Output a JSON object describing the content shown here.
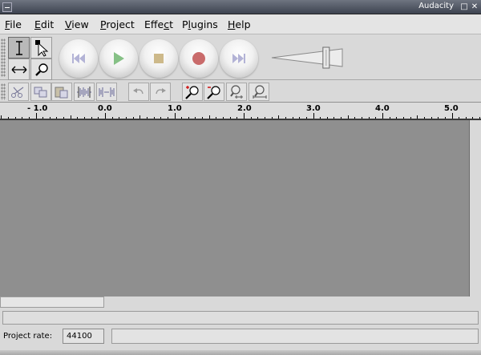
{
  "window": {
    "title": "Audacity"
  },
  "menubar": {
    "items": [
      {
        "before": "",
        "mnemonic": "F",
        "after": "ile"
      },
      {
        "before": "",
        "mnemonic": "E",
        "after": "dit"
      },
      {
        "before": "",
        "mnemonic": "V",
        "after": "iew"
      },
      {
        "before": "",
        "mnemonic": "P",
        "after": "roject"
      },
      {
        "before": "Effe",
        "mnemonic": "c",
        "after": "t"
      },
      {
        "before": "P",
        "mnemonic": "l",
        "after": "ugins"
      },
      {
        "before": "",
        "mnemonic": "H",
        "after": "elp"
      }
    ]
  },
  "tools": {
    "selection_tool": {
      "icon": "i-beam-icon",
      "active": true
    },
    "envelope_tool": {
      "icon": "envelope-cursor-icon"
    },
    "timeshift_tool": {
      "icon": "double-arrow-icon"
    },
    "zoom_tool": {
      "icon": "magnifier-icon"
    }
  },
  "transport": {
    "skip_start": {
      "icon": "skip-to-start-icon",
      "color": "#b3b3d6"
    },
    "play": {
      "icon": "play-icon",
      "color": "#86c186"
    },
    "stop": {
      "icon": "stop-icon",
      "color": "#cdb98a"
    },
    "record": {
      "icon": "record-icon",
      "color": "#c96b6b"
    },
    "skip_end": {
      "icon": "skip-to-end-icon",
      "color": "#b3b3d6"
    }
  },
  "volume": {
    "level": 0.76
  },
  "edit_toolbar": [
    {
      "name": "cut-button",
      "icon": "scissors-icon"
    },
    {
      "name": "copy-button",
      "icon": "copy-icon"
    },
    {
      "name": "paste-button",
      "icon": "paste-icon"
    },
    {
      "name": "trim-button",
      "icon": "trim-icon"
    },
    {
      "name": "silence-button",
      "icon": "silence-icon"
    },
    {
      "name": "undo-button",
      "icon": "undo-icon"
    },
    {
      "name": "redo-button",
      "icon": "redo-icon"
    },
    {
      "name": "zoom-in-button",
      "icon": "zoom-in-icon"
    },
    {
      "name": "zoom-out-button",
      "icon": "zoom-out-icon"
    },
    {
      "name": "fit-selection-button",
      "icon": "zoom-fit-selection-icon"
    },
    {
      "name": "fit-project-button",
      "icon": "zoom-fit-project-icon"
    }
  ],
  "ruler": {
    "labels": [
      "- 1.0",
      "0.0",
      "1.0",
      "2.0",
      "3.0",
      "4.0",
      "5.0"
    ]
  },
  "footer": {
    "project_rate_label": "Project rate:",
    "project_rate_value": "44100",
    "status_text": ""
  },
  "colors": {
    "track_background": "#8f8f8f",
    "toolbar_background": "#d9d9d9",
    "titlebar": "#4a505c"
  }
}
